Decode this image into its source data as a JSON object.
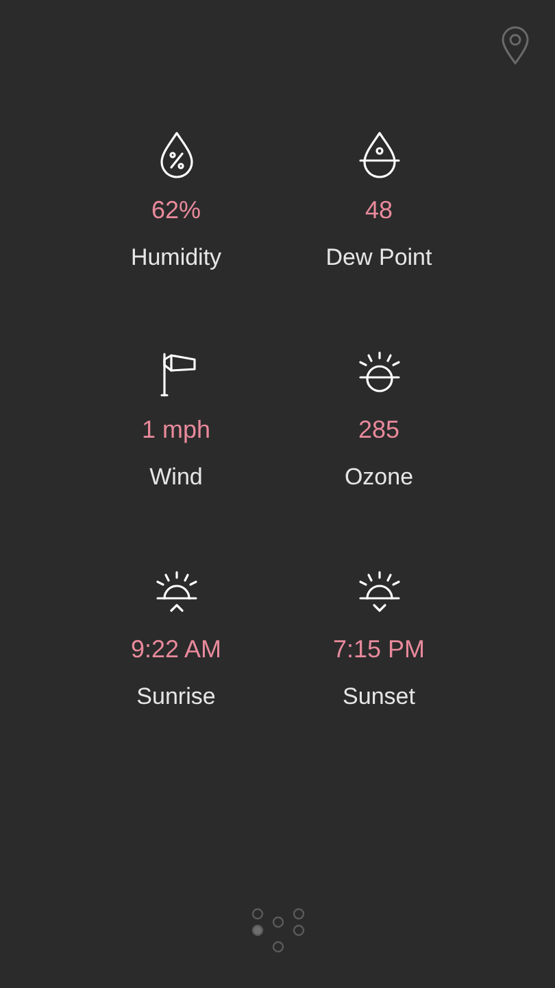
{
  "items": [
    {
      "kind": "humidity",
      "value": "62%",
      "label": "Humidity"
    },
    {
      "kind": "dew_point",
      "value": "48",
      "label": "Dew Point"
    },
    {
      "kind": "wind",
      "value": "1 mph",
      "label": "Wind"
    },
    {
      "kind": "ozone",
      "value": "285",
      "label": "Ozone"
    },
    {
      "kind": "sunrise",
      "value": "9:22 AM",
      "label": "Sunrise"
    },
    {
      "kind": "sunset",
      "value": "7:15 PM",
      "label": "Sunset"
    }
  ],
  "pages": [
    {
      "selected": false
    },
    {
      "selected": false
    },
    {
      "selected": false
    },
    {
      "selected": true
    },
    {
      "selected": false
    },
    {
      "selected": false
    }
  ]
}
